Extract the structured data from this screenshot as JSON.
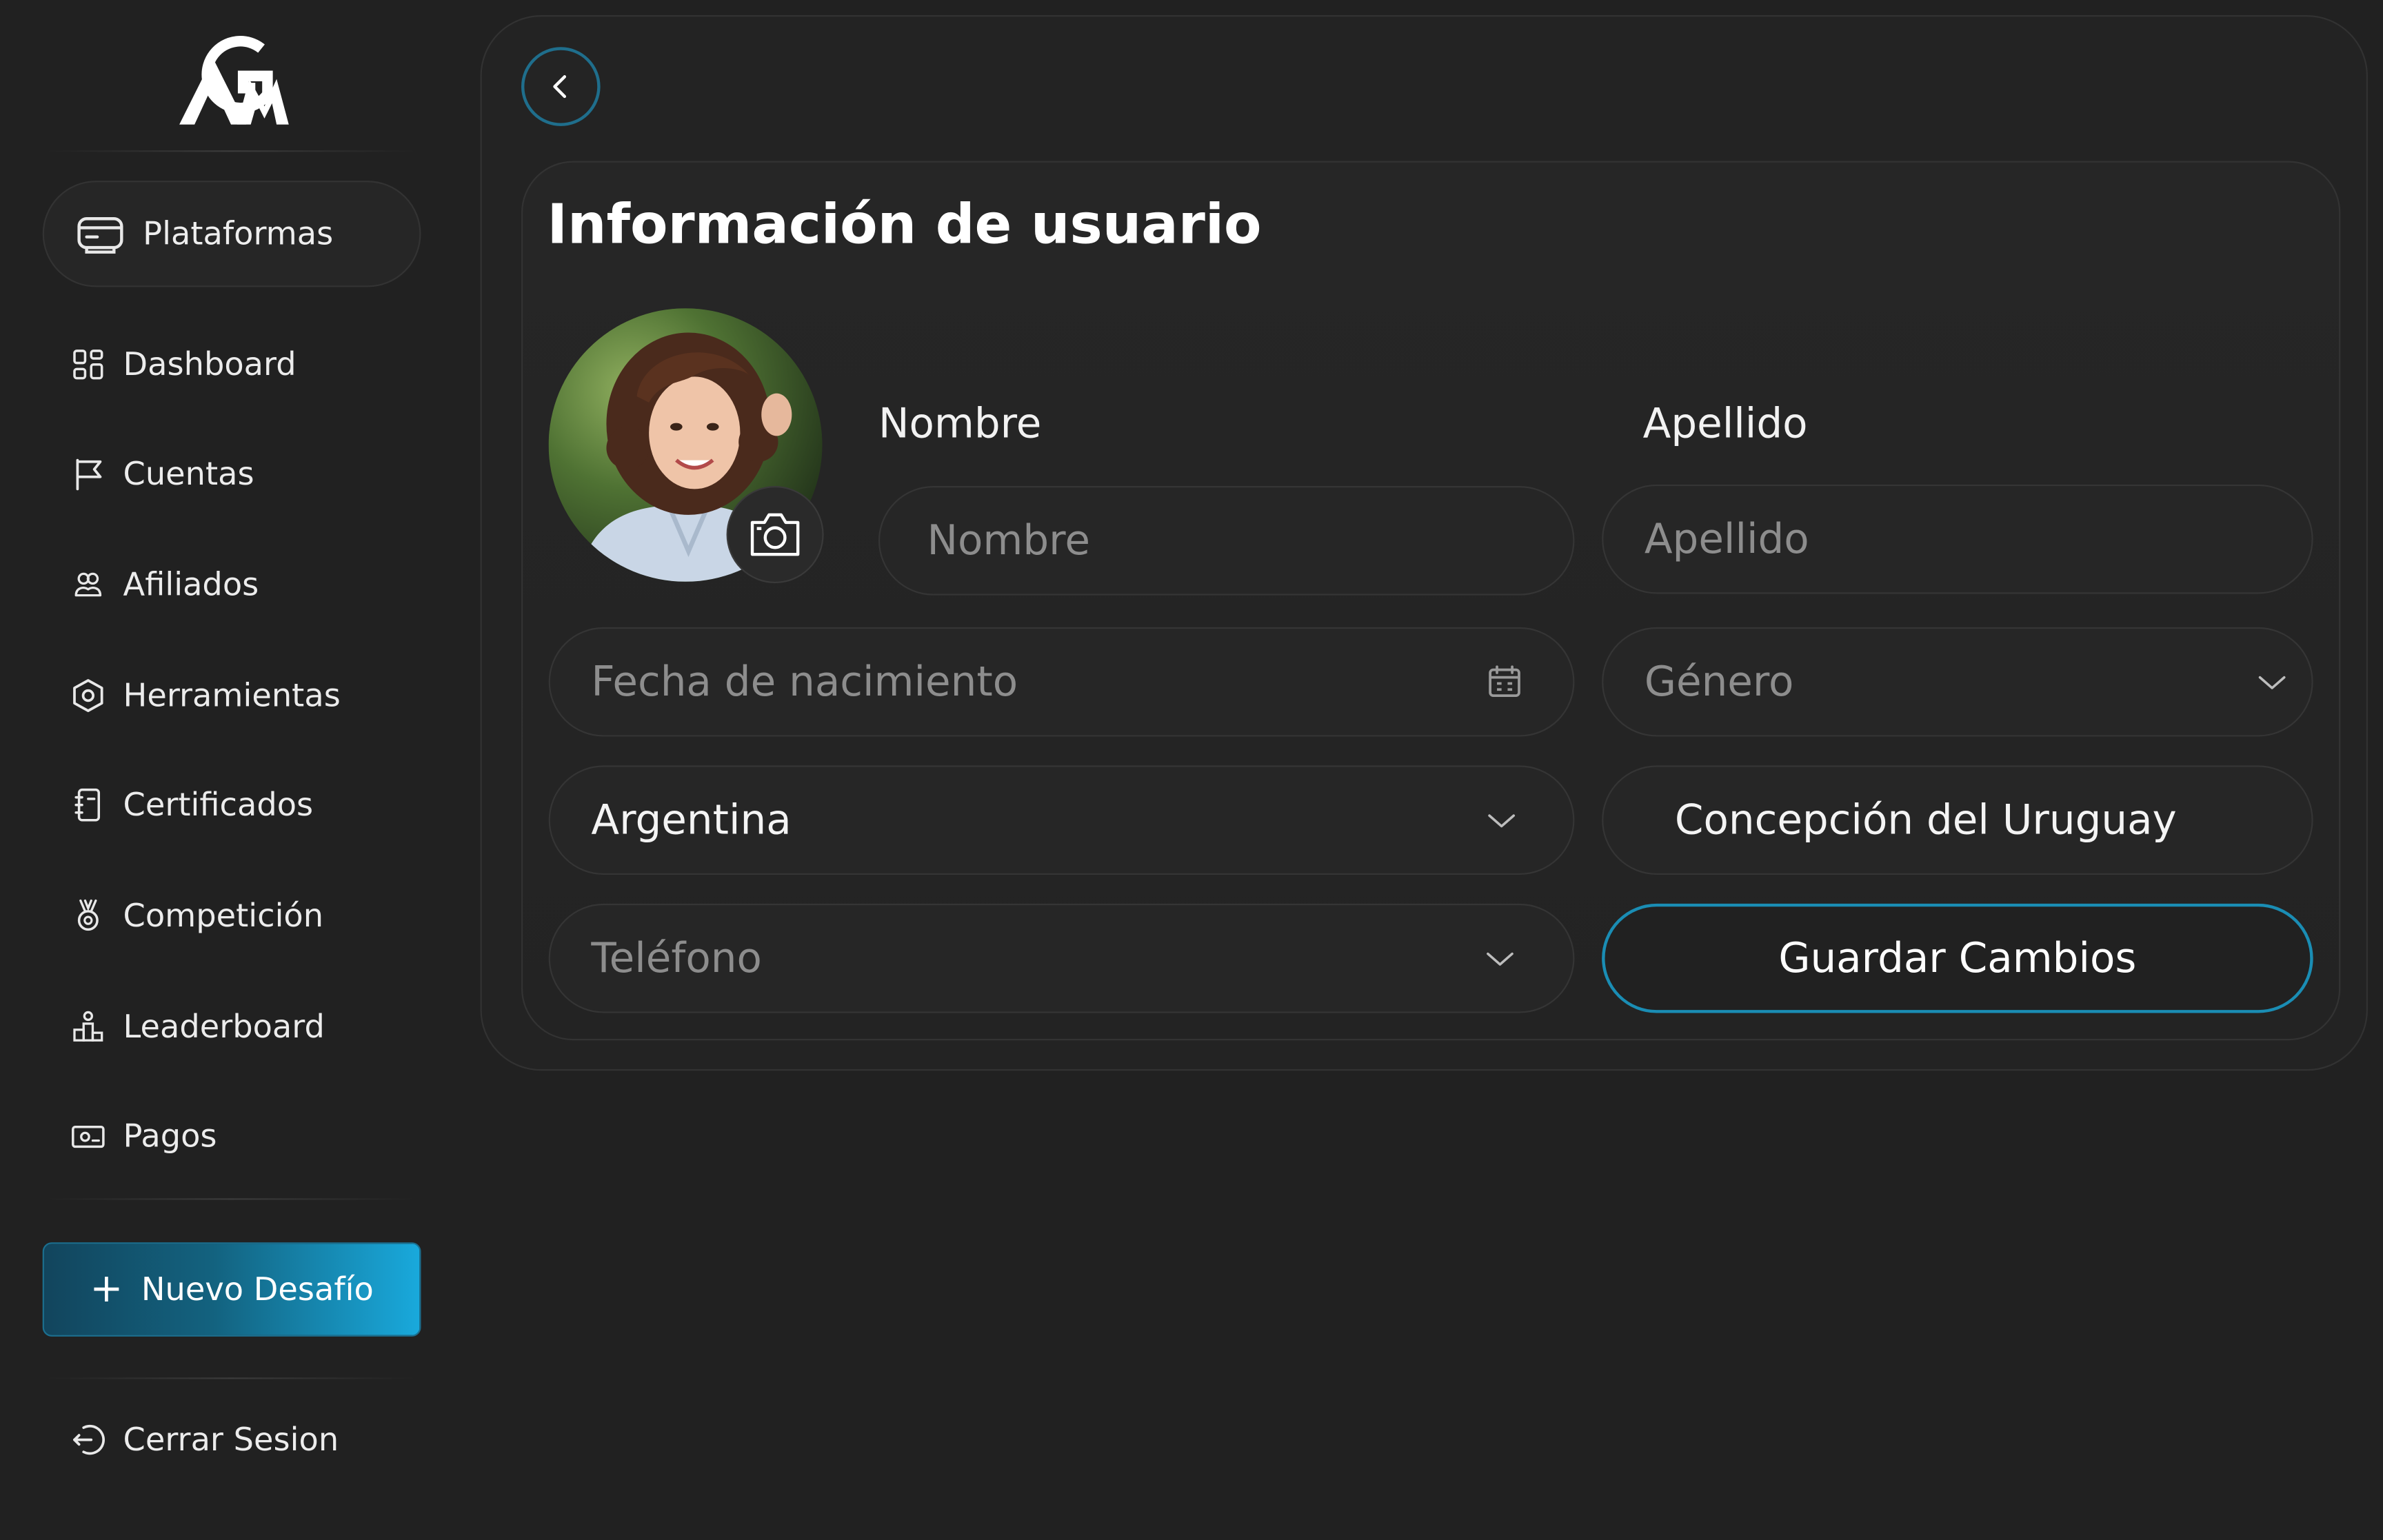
{
  "sidebar": {
    "logo_text": "AGM",
    "platforms_label": "Plataformas",
    "items": [
      {
        "label": "Dashboard",
        "icon": "grid-icon"
      },
      {
        "label": "Cuentas",
        "icon": "flag-icon"
      },
      {
        "label": "Afiliados",
        "icon": "users-icon"
      },
      {
        "label": "Herramientas",
        "icon": "hexagon-icon"
      },
      {
        "label": "Certificados",
        "icon": "certificate-icon"
      },
      {
        "label": "Competición",
        "icon": "medal-icon"
      },
      {
        "label": "Leaderboard",
        "icon": "podium-icon"
      },
      {
        "label": "Pagos",
        "icon": "money-icon"
      }
    ],
    "new_challenge_label": "Nuevo Desafío",
    "logout_label": "Cerrar Sesion"
  },
  "main": {
    "title": "Información de usuario",
    "first_name": {
      "label": "Nombre",
      "placeholder": "Nombre"
    },
    "last_name": {
      "label": "Apellido",
      "placeholder": "Apellido"
    },
    "birthdate": {
      "placeholder": "Fecha de nacimiento"
    },
    "gender": {
      "placeholder": "Género"
    },
    "country": {
      "value": "Argentina"
    },
    "city": {
      "value": "Concepción del Uruguay"
    },
    "phone": {
      "placeholder": "Teléfono"
    },
    "save_label": "Guardar Cambios"
  },
  "colors": {
    "background": "#212121",
    "accent": "#1a8db4",
    "accent_gradient_end": "#19a9dc"
  }
}
